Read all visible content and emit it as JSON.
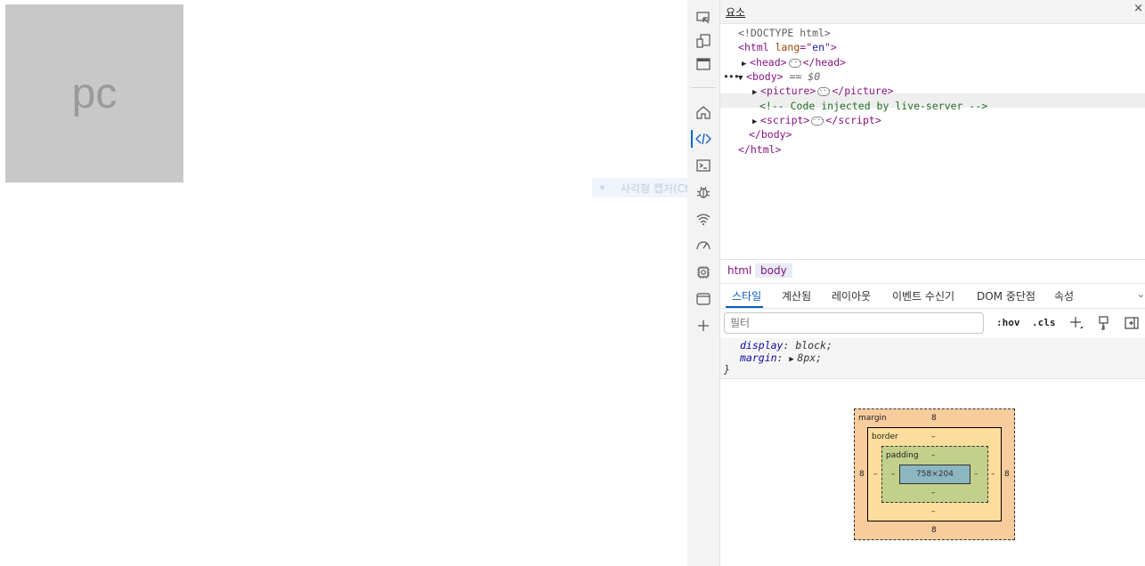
{
  "page": {
    "box_text": "pc",
    "ghost_text": "사각형 캡처(Ctrl+)"
  },
  "panel": {
    "title": "요소",
    "close": "×"
  },
  "activity": {
    "icons": [
      "inspect-icon",
      "device-emulation-icon",
      "toggle-panel-icon",
      "welcome-home-icon",
      "elements-icon",
      "console-icon",
      "sources-bug-icon",
      "network-wifi-icon",
      "performance-icon",
      "memory-settings-icon",
      "application-icon",
      "more-tools-icon"
    ]
  },
  "dom": {
    "doctype": "<!DOCTYPE html>",
    "html_open": {
      "tag": "html",
      "attr": "lang",
      "value": "en"
    },
    "head": "head",
    "body": "body",
    "selected_suffix": "== $0",
    "ellipsis": "•••",
    "children": [
      {
        "kind": "element",
        "tag": "picture"
      },
      {
        "kind": "comment",
        "text": "<!-- Code injected by live-server -->"
      },
      {
        "kind": "element",
        "tag": "script"
      }
    ],
    "body_close": "</body>",
    "html_close": "</html>"
  },
  "breadcrumbs": [
    "html",
    "body"
  ],
  "tabs": [
    "스타일",
    "계산됨",
    "레이아웃",
    "이벤트 수신기",
    "DOM 중단점",
    "속성"
  ],
  "filter": {
    "placeholder": "필터",
    "hov": ":hov",
    "cls": ".cls"
  },
  "styles": {
    "rules": [
      {
        "prop": "display",
        "value": "block;"
      },
      {
        "prop": "margin",
        "value": "8px;"
      }
    ],
    "closing": "}"
  },
  "box_model": {
    "margin_label": "margin",
    "margin_top": "8",
    "margin_right": "8",
    "margin_bottom": "8",
    "margin_left": "8",
    "border_label": "border",
    "border_top": "–",
    "border_right": "–",
    "border_bottom": "–",
    "border_left": "–",
    "padding_label": "padding",
    "padding_top": "–",
    "padding_right": "–",
    "padding_bottom": "–",
    "padding_left": "–",
    "content": "758×204"
  },
  "colors": {
    "accent": "#0b5cbe",
    "tag": "#881280",
    "comment": "#236e25"
  }
}
